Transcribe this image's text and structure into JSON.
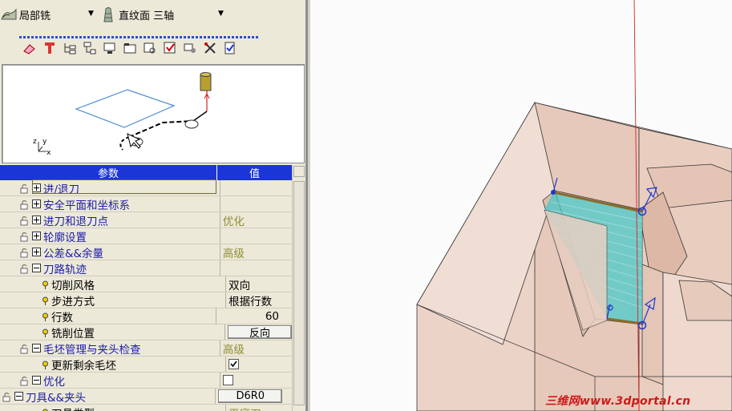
{
  "toolbar": {
    "strategy_label": "局部铣",
    "surface_label": "直纹面 三轴",
    "icons": [
      "eraser-icon",
      "tool-icon",
      "tree-edit-icon",
      "tree-icon",
      "display-icon",
      "folder-display-icon",
      "print-preview-icon",
      "save-icon",
      "settings-icon",
      "tools-icon",
      "report-icon"
    ]
  },
  "preview": {
    "axis_z": "z",
    "axis_y": "y",
    "axis_x": "x"
  },
  "grid": {
    "header_param": "参数",
    "header_value": "值",
    "rows": [
      {
        "label": "进/退刀",
        "value": ""
      },
      {
        "label": "安全平面和坐标系",
        "value": ""
      },
      {
        "label": "进刀和退刀点",
        "value": "优化"
      },
      {
        "label": "轮廓设置",
        "value": ""
      },
      {
        "label": "公差&&余量",
        "value": "高级"
      },
      {
        "label": "刀路轨迹",
        "value": ""
      },
      {
        "label": "切削风格",
        "value": "双向"
      },
      {
        "label": "步进方式",
        "value": "根据行数"
      },
      {
        "label": "行数",
        "value": "60"
      },
      {
        "label": "铣削位置",
        "value": "反向"
      },
      {
        "label": "毛坯管理与夹头检查",
        "value": "高级"
      },
      {
        "label": "更新剩余毛坯",
        "value": ""
      },
      {
        "label": "优化",
        "value": ""
      },
      {
        "label": "刀具&&夹头",
        "value": "D6R0"
      },
      {
        "label": "刀具类型",
        "value": "平底刀"
      }
    ]
  },
  "watermark": "三维网www.3dportal.cn",
  "colors": {
    "header": "#1a36d6",
    "option_text": "#8f8d3a",
    "tree_text": "#1c1ca8",
    "part_face": "#ecd3c7",
    "toolpath": "#48c8c8"
  }
}
